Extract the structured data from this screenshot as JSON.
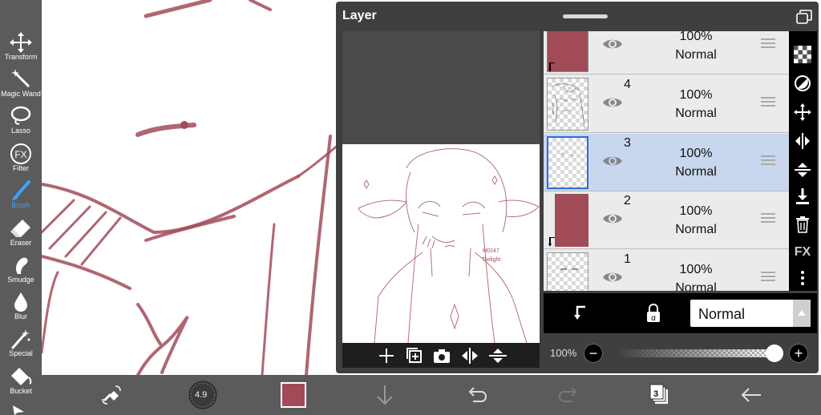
{
  "toolbar": {
    "tools": [
      {
        "label": "Transform",
        "icon": "move-arrows-icon"
      },
      {
        "label": "Magic Wand",
        "icon": "magic-wand-icon"
      },
      {
        "label": "Lasso",
        "icon": "lasso-icon"
      },
      {
        "label": "Filter",
        "icon": "fx-icon",
        "glyph": "FX"
      },
      {
        "label": "Brush",
        "icon": "brush-icon"
      },
      {
        "label": "Eraser",
        "icon": "eraser-icon"
      },
      {
        "label": "Smudge",
        "icon": "smudge-icon"
      },
      {
        "label": "Blur",
        "icon": "blur-drop-icon"
      },
      {
        "label": "Special",
        "icon": "special-wand-icon"
      },
      {
        "label": "Bucket",
        "icon": "bucket-icon"
      }
    ],
    "active_tool": "Brush"
  },
  "layer_panel": {
    "title": "Layer",
    "preview_text": {
      "line1": "H0247",
      "line2": "Twilight"
    },
    "layers": [
      {
        "number": "",
        "opacity": "100%",
        "blend": "Normal",
        "visible": true,
        "clipped": true,
        "fill": "#a24b58"
      },
      {
        "number": "4",
        "opacity": "100%",
        "blend": "Normal",
        "visible": true,
        "clipped": false,
        "fill": "sketch"
      },
      {
        "number": "3",
        "opacity": "100%",
        "blend": "Normal",
        "visible": true,
        "clipped": false,
        "fill": "transparent",
        "selected": true
      },
      {
        "number": "2",
        "opacity": "100%",
        "blend": "Normal",
        "visible": true,
        "clipped": true,
        "fill": "#a24b58"
      },
      {
        "number": "1",
        "opacity": "100%",
        "blend": "Normal",
        "visible": true,
        "clipped": false,
        "fill": "lines"
      }
    ],
    "right_icons": [
      "checker-icon",
      "mask-circle-icon",
      "move-layer-icon",
      "flip-horizontal-icon",
      "flip-vertical-icon",
      "merge-down-icon",
      "trash-icon",
      "fx-text-icon",
      "more-vertical-icon"
    ],
    "right_fx_label": "FX",
    "blend_mode": "Normal",
    "opacity_label": "100%",
    "opacity_value": 1.0,
    "minus_label": "−",
    "plus_label": "+"
  },
  "bottom_bar": {
    "brush_size": "4.9",
    "color": "#a24b58",
    "layer_count": "3"
  },
  "colors": {
    "sketch": "#a24b58",
    "toolbar": "#5b5b5b",
    "panel": "#3f3f3f",
    "selected_row": "#c9d7ee",
    "accent": "#3fa0ff"
  }
}
